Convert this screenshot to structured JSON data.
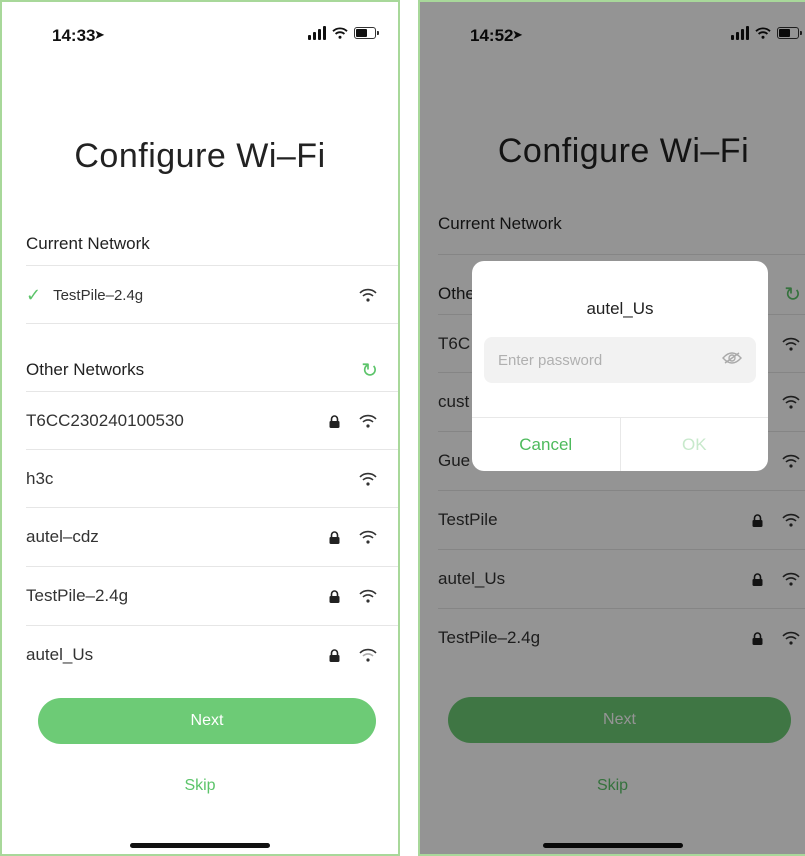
{
  "left": {
    "status": {
      "time": "14:33"
    },
    "title": "Configure Wi–Fi",
    "current_network": {
      "heading": "Current Network",
      "name": "TestPile–2.4g"
    },
    "other_networks": {
      "heading": "Other Networks",
      "items": [
        {
          "name": "T6CC230240100530",
          "locked": true
        },
        {
          "name": "h3c",
          "locked": false
        },
        {
          "name": "autel–cdz",
          "locked": true
        },
        {
          "name": "TestPile–2.4g",
          "locked": true
        },
        {
          "name": "autel_Us",
          "locked": true
        }
      ]
    },
    "next_label": "Next",
    "skip_label": "Skip"
  },
  "right": {
    "status": {
      "time": "14:52"
    },
    "title": "Configure Wi–Fi",
    "current_network": {
      "heading": "Current Network"
    },
    "other_networks": {
      "heading": "Othe",
      "items": [
        {
          "name": "T6C",
          "locked": false
        },
        {
          "name": "cust",
          "locked": false
        },
        {
          "name": "Gue",
          "locked": false
        },
        {
          "name": "TestPile",
          "locked": true
        },
        {
          "name": "autel_Us",
          "locked": true
        },
        {
          "name": "TestPile–2.4g",
          "locked": true
        }
      ]
    },
    "next_label": "Next",
    "skip_label": "Skip",
    "dialog": {
      "title": "autel_Us",
      "password_placeholder": "Enter password",
      "cancel_label": "Cancel",
      "ok_label": "OK"
    }
  },
  "colors": {
    "accent": "#5cc46a",
    "button": "#6dcb76",
    "frame": "#a8d89a"
  }
}
